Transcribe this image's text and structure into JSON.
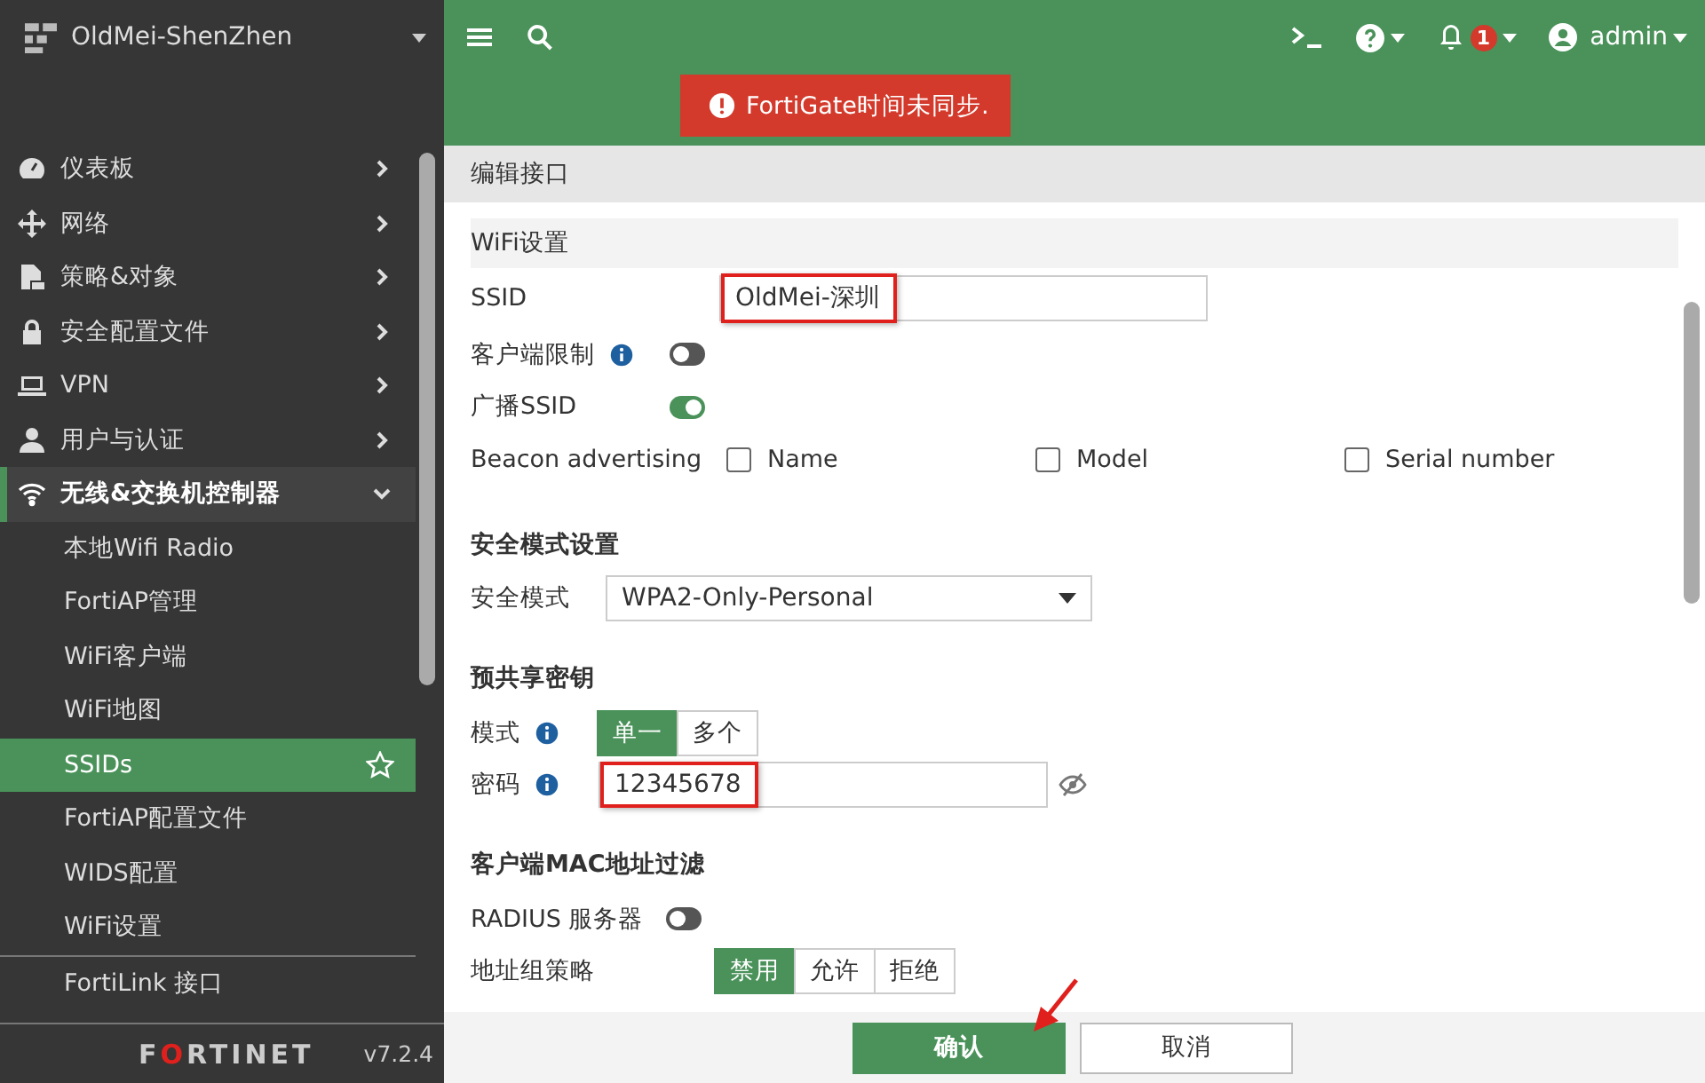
{
  "sidebar": {
    "device": "OldMei-ShenZhen",
    "menu": [
      {
        "label": "仪表板",
        "selected": false,
        "expanded": false
      },
      {
        "label": "网络",
        "selected": false,
        "expanded": false
      },
      {
        "label": "策略&对象",
        "selected": false,
        "expanded": false
      },
      {
        "label": "安全配置文件",
        "selected": false,
        "expanded": false
      },
      {
        "label": "VPN",
        "selected": false,
        "expanded": false
      },
      {
        "label": "用户与认证",
        "selected": false,
        "expanded": false
      },
      {
        "label": "无线&交换机控制器",
        "selected": true,
        "expanded": true,
        "children": [
          {
            "label": "本地Wifi Radio",
            "selected": false,
            "favorite": false
          },
          {
            "label": "FortiAP管理",
            "selected": false,
            "favorite": false
          },
          {
            "label": "WiFi客户端",
            "selected": false,
            "favorite": false
          },
          {
            "label": "WiFi地图",
            "selected": false,
            "favorite": false
          },
          {
            "label": "SSIDs",
            "selected": true,
            "favorite": true
          },
          {
            "label": "FortiAP配置文件",
            "selected": false,
            "favorite": false
          },
          {
            "label": "WIDS配置",
            "selected": false,
            "favorite": false
          },
          {
            "label": "WiFi设置",
            "selected": false,
            "favorite": false
          },
          {
            "label": "FortiLink 接口",
            "selected": false,
            "favorite": false
          }
        ]
      }
    ],
    "logo": "FORTINET",
    "version": "v7.2.4"
  },
  "topbar": {
    "notifications": "1",
    "user": "admin"
  },
  "alert": "FortiGate时间未同步.",
  "page_title": "编辑接口",
  "wifi": {
    "title": "WiFi设置",
    "ssid": {
      "label": "SSID",
      "value": "OldMei-深圳",
      "highlighted": true
    },
    "client_limit": {
      "label": "客户端限制",
      "on": false
    },
    "broadcast": {
      "label": "广播SSID",
      "on": true
    },
    "beacon": {
      "label": "Beacon advertising",
      "options": [
        {
          "label": "Name",
          "checked": false
        },
        {
          "label": "Model",
          "checked": false
        },
        {
          "label": "Serial number",
          "checked": false
        }
      ]
    }
  },
  "security": {
    "title": "安全模式设置",
    "mode": {
      "label": "安全模式",
      "value": "WPA2-Only-Personal"
    }
  },
  "psk": {
    "title": "预共享密钥",
    "mode": {
      "label": "模式",
      "options": [
        {
          "label": "单一",
          "selected": true
        },
        {
          "label": "多个",
          "selected": false
        }
      ]
    },
    "password": {
      "label": "密码",
      "value": "12345678",
      "highlighted": true
    }
  },
  "mac_filter": {
    "title": "客户端MAC地址过滤",
    "radius": {
      "label": "RADIUS 服务器",
      "on": false
    },
    "policy": {
      "label": "地址组策略",
      "options": [
        {
          "label": "禁用",
          "selected": true
        },
        {
          "label": "允许",
          "selected": false
        },
        {
          "label": "拒绝",
          "selected": false
        }
      ]
    }
  },
  "buttons": [
    {
      "label": "确认",
      "kind": "primary"
    },
    {
      "label": "取消",
      "kind": "secondary"
    }
  ]
}
